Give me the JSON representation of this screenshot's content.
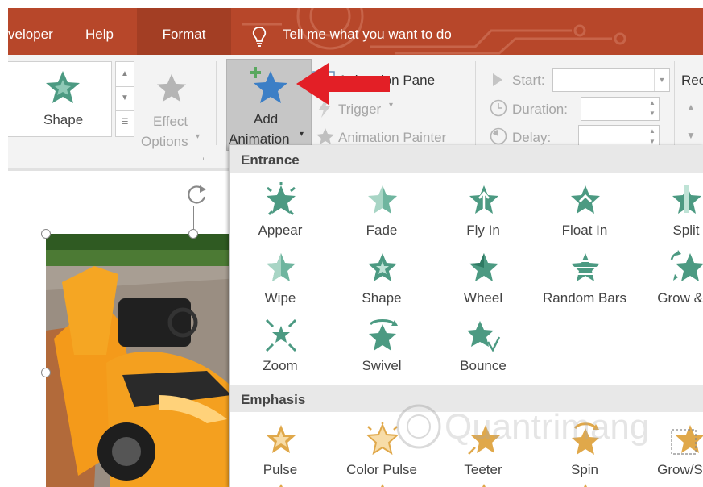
{
  "tabs": {
    "developer": "veloper",
    "help": "Help",
    "format": "Format",
    "tell_me": "Tell me what you want to do"
  },
  "ribbon": {
    "shape_label": "Shape",
    "effect_options": [
      "Effect",
      "Options"
    ],
    "add_animation": [
      "Add",
      "Animation"
    ],
    "animation_pane": "Animation Pane",
    "trigger": "Trigger",
    "animation_painter": "Animation Painter",
    "start": "Start:",
    "duration": "Duration:",
    "delay": "Delay:",
    "reorder": "Rec"
  },
  "entrance": {
    "title": "Entrance",
    "effects": [
      "Appear",
      "Fade",
      "Fly In",
      "Float In",
      "Split",
      "Wipe",
      "Shape",
      "Wheel",
      "Random Bars",
      "Grow & T",
      "Zoom",
      "Swivel",
      "Bounce"
    ]
  },
  "emphasis": {
    "title": "Emphasis",
    "effects": [
      "Pulse",
      "Color Pulse",
      "Teeter",
      "Spin",
      "Grow/Shr"
    ]
  },
  "colors": {
    "tab_bar": "#b7472a",
    "entrance_green": "#4c9a82",
    "emphasis_gold": "#e0a84a",
    "add_star_blue": "#3c7fc6",
    "arrow_red": "#e31f26"
  },
  "icons": {
    "tell_me": "lightbulb-icon",
    "add_animation": "blue-star-plus-icon",
    "animation_pane": "animation-pane-icon",
    "trigger": "lightning-icon",
    "painter": "star-brush-icon",
    "start": "play-triangle-icon",
    "duration": "clock-icon",
    "delay": "clock-icon"
  },
  "watermark": "Quantrimang"
}
